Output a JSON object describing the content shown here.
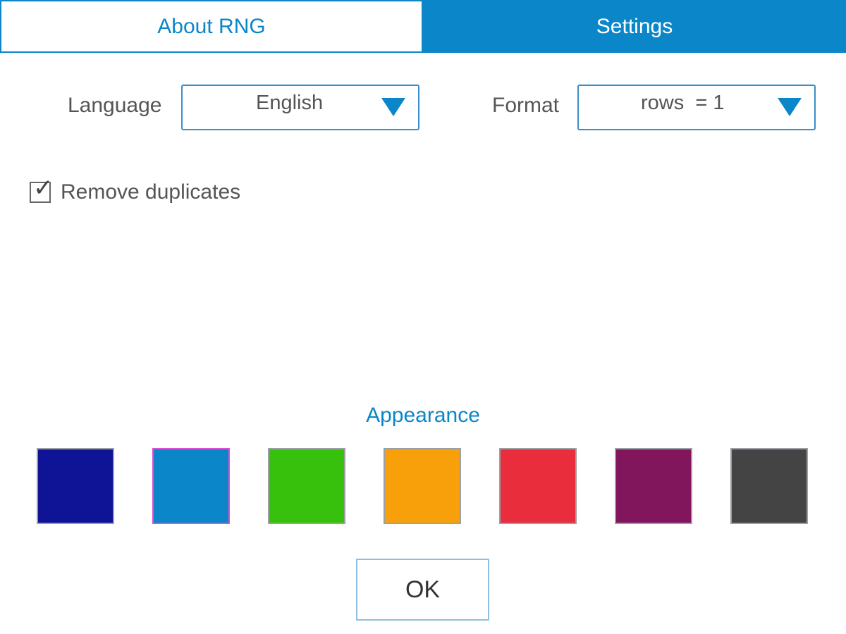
{
  "tabs": [
    {
      "label": "About RNG",
      "active": false
    },
    {
      "label": "Settings",
      "active": true
    }
  ],
  "settings": {
    "language_label": "Language",
    "language_value": "English",
    "format_label": "Format",
    "format_value": "rows  = 1",
    "remove_duplicates_label": "Remove duplicates",
    "remove_duplicates_checked": true
  },
  "appearance": {
    "title": "Appearance",
    "selected_index": 1,
    "swatches": [
      {
        "name": "navy",
        "color": "#0f1496"
      },
      {
        "name": "blue",
        "color": "#0a86c9"
      },
      {
        "name": "green",
        "color": "#38c10c"
      },
      {
        "name": "orange",
        "color": "#f7a00a"
      },
      {
        "name": "red",
        "color": "#ea2d3d"
      },
      {
        "name": "purple",
        "color": "#81165d"
      },
      {
        "name": "dark-gray",
        "color": "#444444"
      }
    ]
  },
  "ok_label": "OK",
  "colors": {
    "accent": "#0a86c9",
    "text": "#555555",
    "selection_border": "#e04ed1"
  },
  "icons": {
    "dropdown": "caret-down-icon",
    "check": "checkmark-icon"
  }
}
